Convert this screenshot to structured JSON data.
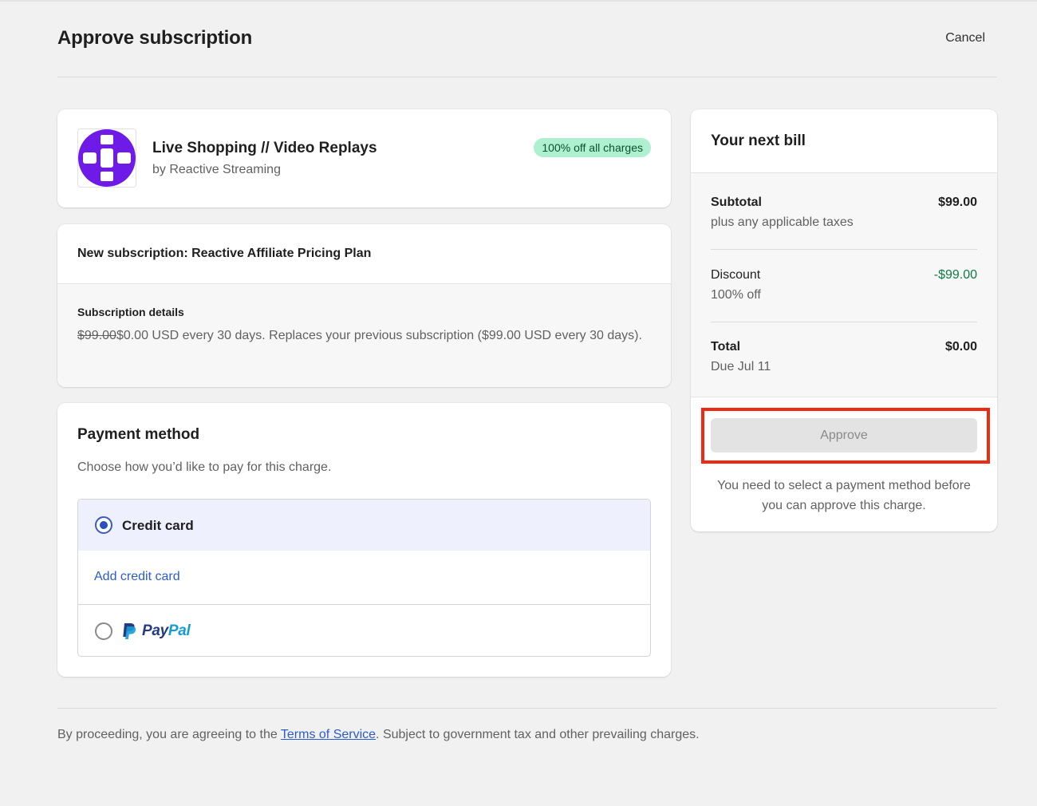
{
  "header": {
    "title": "Approve subscription",
    "cancel_label": "Cancel"
  },
  "app": {
    "name": "Live Shopping // Video Replays",
    "vendor": "by Reactive Streaming",
    "badge": "100% off all charges",
    "logo_color": "#6e1be8"
  },
  "subscription": {
    "heading": "New subscription: Reactive Affiliate Pricing Plan",
    "details_label": "Subscription details",
    "old_price": "$99.00",
    "details_text": "$0.00 USD every 30 days. Replaces your previous subscription ($99.00 USD every 30 days)."
  },
  "payment": {
    "title": "Payment method",
    "subtitle": "Choose how you’d like to pay for this charge.",
    "credit_card_label": "Credit card",
    "add_credit_card_label": "Add credit card",
    "paypal_label_pay": "Pay",
    "paypal_label_pal": "Pal",
    "selected": "Credit card"
  },
  "bill": {
    "title": "Your next bill",
    "rows": [
      {
        "label": "Subtotal",
        "sub": "plus any applicable taxes",
        "amount": "$99.00"
      },
      {
        "label": "Discount",
        "sub": "100% off",
        "amount": "-$99.00"
      },
      {
        "label": "Total",
        "sub": "Due Jul 11",
        "amount": "$0.00"
      }
    ],
    "approve_label": "Approve",
    "approve_note": "You need to select a payment method before you can approve this charge."
  },
  "footer": {
    "prefix": "By proceeding, you are agreeing to the ",
    "link": "Terms of Service",
    "suffix": ". Subject to government tax and other prevailing charges."
  },
  "colors": {
    "accent_blue": "#2c5bd0",
    "badge_bg": "#aef0cf",
    "discount_green": "#0f7a47",
    "highlight_red": "#ef2a12"
  }
}
